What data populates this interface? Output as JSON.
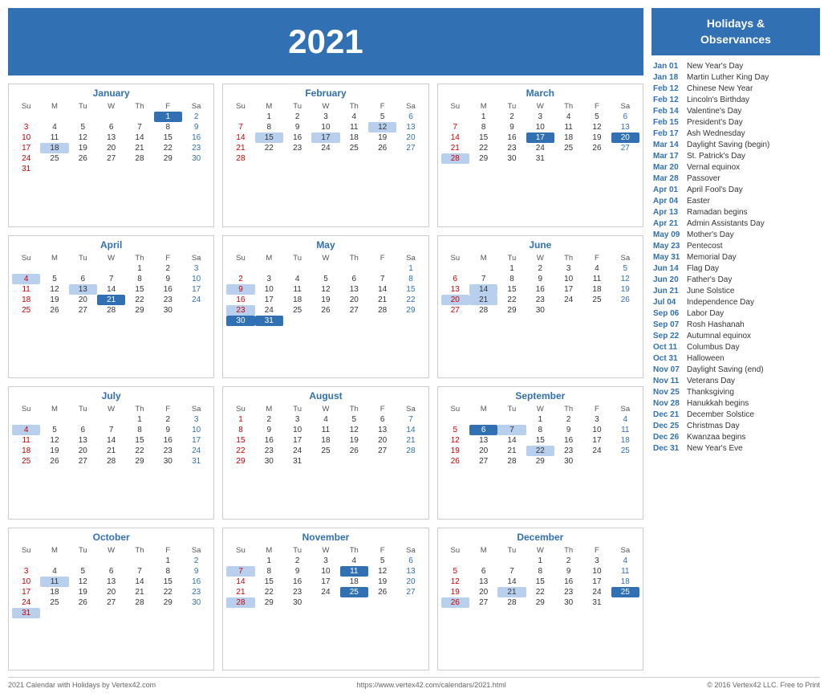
{
  "year": "2021",
  "footer": {
    "left": "2021 Calendar with Holidays by Vertex42.com",
    "center": "https://www.vertex42.com/calendars/2021.html",
    "right": "© 2016 Vertex42 LLC. Free to Print"
  },
  "sidebar": {
    "title": "Holidays &\nObservances",
    "holidays": [
      {
        "date": "Jan 01",
        "name": "New Year's Day"
      },
      {
        "date": "Jan 18",
        "name": "Martin Luther King Day"
      },
      {
        "date": "Feb 12",
        "name": "Chinese New Year"
      },
      {
        "date": "Feb 12",
        "name": "Lincoln's Birthday"
      },
      {
        "date": "Feb 14",
        "name": "Valentine's Day"
      },
      {
        "date": "Feb 15",
        "name": "President's Day"
      },
      {
        "date": "Feb 17",
        "name": "Ash Wednesday"
      },
      {
        "date": "Mar 14",
        "name": "Daylight Saving (begin)"
      },
      {
        "date": "Mar 17",
        "name": "St. Patrick's Day"
      },
      {
        "date": "Mar 20",
        "name": "Vernal equinox"
      },
      {
        "date": "Mar 28",
        "name": "Passover"
      },
      {
        "date": "Apr 01",
        "name": "April Fool's Day"
      },
      {
        "date": "Apr 04",
        "name": "Easter"
      },
      {
        "date": "Apr 13",
        "name": "Ramadan begins"
      },
      {
        "date": "Apr 21",
        "name": "Admin Assistants Day"
      },
      {
        "date": "May 09",
        "name": "Mother's Day"
      },
      {
        "date": "May 23",
        "name": "Pentecost"
      },
      {
        "date": "May 31",
        "name": "Memorial Day"
      },
      {
        "date": "Jun 14",
        "name": "Flag Day"
      },
      {
        "date": "Jun 20",
        "name": "Father's Day"
      },
      {
        "date": "Jun 21",
        "name": "June Solstice"
      },
      {
        "date": "Jul 04",
        "name": "Independence Day"
      },
      {
        "date": "Sep 06",
        "name": "Labor Day"
      },
      {
        "date": "Sep 07",
        "name": "Rosh Hashanah"
      },
      {
        "date": "Sep 22",
        "name": "Autumnal equinox"
      },
      {
        "date": "Oct 11",
        "name": "Columbus Day"
      },
      {
        "date": "Oct 31",
        "name": "Halloween"
      },
      {
        "date": "Nov 07",
        "name": "Daylight Saving (end)"
      },
      {
        "date": "Nov 11",
        "name": "Veterans Day"
      },
      {
        "date": "Nov 25",
        "name": "Thanksgiving"
      },
      {
        "date": "Nov 28",
        "name": "Hanukkah begins"
      },
      {
        "date": "Dec 21",
        "name": "December Solstice"
      },
      {
        "date": "Dec 25",
        "name": "Christmas Day"
      },
      {
        "date": "Dec 26",
        "name": "Kwanzaa begins"
      },
      {
        "date": "Dec 31",
        "name": "New Year's Eve"
      }
    ]
  }
}
